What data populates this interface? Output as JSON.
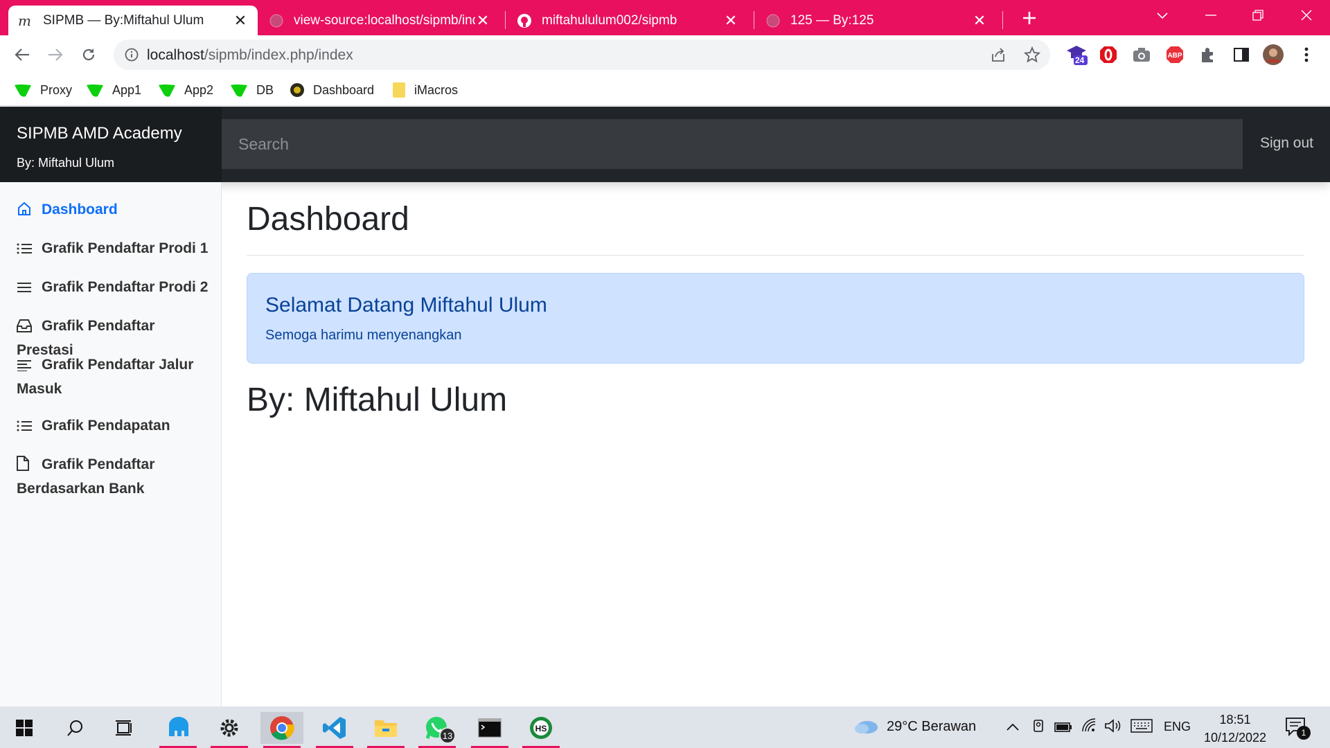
{
  "browser": {
    "tabs": [
      {
        "title": "SIPMB — By:Miftahul Ulum",
        "active": true
      },
      {
        "title": "view-source:localhost/sipmb/ind",
        "active": false
      },
      {
        "title": "miftahululum002/sipmb",
        "active": false
      },
      {
        "title": "125 — By:125",
        "active": false
      }
    ],
    "url_host": "localhost",
    "url_path": "/sipmb/index.php/index",
    "extension_badge": "24",
    "bookmarks": [
      {
        "label": "Proxy"
      },
      {
        "label": "App1"
      },
      {
        "label": "App2"
      },
      {
        "label": "DB"
      },
      {
        "label": "Dashboard"
      },
      {
        "label": "iMacros"
      }
    ]
  },
  "navbar": {
    "brand": "SIPMB AMD Academy",
    "brand_sub": "By: Miftahul Ulum",
    "search_placeholder": "Search",
    "signout": "Sign out"
  },
  "sidebar": {
    "items": [
      {
        "label": "Dashboard",
        "icon": "home-icon",
        "active": true
      },
      {
        "label": "Grafik Pendaftar Prodi 1",
        "icon": "list-icon"
      },
      {
        "label": "Grafik Pendaftar Prodi 2",
        "icon": "menu-icon"
      },
      {
        "label": "Grafik Pendaftar Prestasi",
        "icon": "inbox-icon"
      },
      {
        "label": "Grafik Pendaftar Jalur Masuk",
        "icon": "align-left-icon"
      },
      {
        "label": "Grafik Pendapatan",
        "icon": "list-icon"
      },
      {
        "label": "Grafik Pendaftar Berdasarkan Bank",
        "icon": "file-icon"
      }
    ]
  },
  "main": {
    "title": "Dashboard",
    "alert_heading": "Selamat Datang Miftahul Ulum",
    "alert_text": "Semoga harimu menyenangkan",
    "subheading": "By: Miftahul Ulum"
  },
  "taskbar": {
    "whatsapp_badge": "13",
    "weather": "29°C  Berawan",
    "language": "ENG",
    "time": "18:51",
    "date": "10/12/2022",
    "notification_count": "1"
  },
  "colors": {
    "browser_accent": "#e8105f",
    "navbar_bg": "#212529",
    "alert_bg": "#cfe2ff",
    "alert_text": "#084298",
    "active_link": "#0d6efd"
  }
}
